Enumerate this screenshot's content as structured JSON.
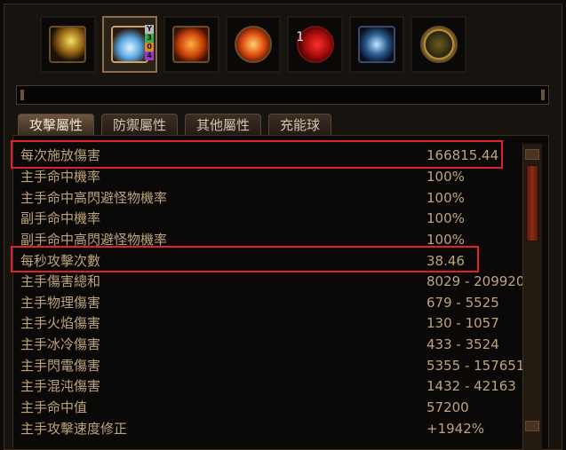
{
  "skills": [
    {
      "icon": "golden-blade-icon",
      "selected": false
    },
    {
      "icon": "ice-hand-icon",
      "selected": true,
      "runes": [
        "Y",
        "3",
        "0",
        "4"
      ]
    },
    {
      "icon": "fire-warrior-icon",
      "selected": false
    },
    {
      "icon": "fire-fist-icon",
      "selected": false
    },
    {
      "icon": "red-orb-icon",
      "selected": false,
      "badge": "1"
    },
    {
      "icon": "lightning-rune-icon",
      "selected": false
    },
    {
      "icon": "gold-shield-icon",
      "selected": false
    }
  ],
  "tabs": [
    "攻擊屬性",
    "防禦屬性",
    "其他屬性",
    "充能球"
  ],
  "stats": [
    {
      "label": "每次施放傷害",
      "value": "166815.44"
    },
    {
      "label": "主手命中機率",
      "value": "100%"
    },
    {
      "label": "主手命中高閃避怪物機率",
      "value": "100%"
    },
    {
      "label": "副手命中機率",
      "value": "100%"
    },
    {
      "label": "副手命中高閃避怪物機率",
      "value": "100%"
    },
    {
      "label": "每秒攻擊次數",
      "value": "38.46"
    },
    {
      "label": "主手傷害總和",
      "value": "8029 - 209920"
    },
    {
      "label": "主手物理傷害",
      "value": "679 - 5525"
    },
    {
      "label": "主手火焰傷害",
      "value": "130 - 1057"
    },
    {
      "label": "主手冰冷傷害",
      "value": "433 - 3524"
    },
    {
      "label": "主手閃電傷害",
      "value": "5355 - 157651"
    },
    {
      "label": "主手混沌傷害",
      "value": "1432 - 42163"
    },
    {
      "label": "主手命中值",
      "value": "57200"
    },
    {
      "label": "主手攻擊速度修正",
      "value": "+1942%"
    }
  ],
  "colors": {
    "accent": "#e0202a",
    "text": "#bda37e"
  }
}
